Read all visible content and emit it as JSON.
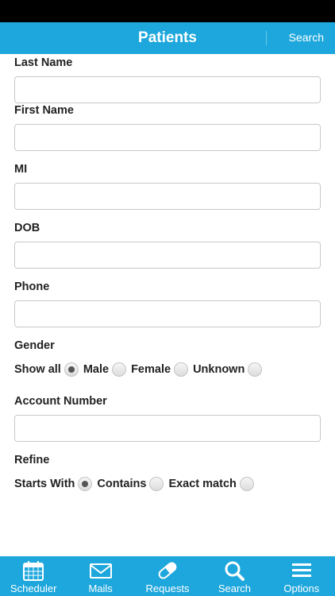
{
  "header": {
    "title": "Patients",
    "search_label": "Search"
  },
  "form": {
    "last_name": {
      "label": "Last Name",
      "value": ""
    },
    "first_name": {
      "label": "First Name",
      "value": ""
    },
    "mi": {
      "label": "MI",
      "value": ""
    },
    "dob": {
      "label": "DOB",
      "value": ""
    },
    "phone": {
      "label": "Phone",
      "value": ""
    },
    "gender": {
      "label": "Gender",
      "options": [
        "Show all",
        "Male",
        "Female",
        "Unknown"
      ],
      "selected": "Show all"
    },
    "account_number": {
      "label": "Account Number",
      "value": ""
    },
    "refine": {
      "label": "Refine",
      "options": [
        "Starts With",
        "Contains",
        "Exact match"
      ],
      "selected": "Starts With"
    }
  },
  "tabbar": {
    "items": [
      {
        "label": "Scheduler",
        "icon": "calendar-icon"
      },
      {
        "label": "Mails",
        "icon": "mail-icon"
      },
      {
        "label": "Requests",
        "icon": "pill-icon"
      },
      {
        "label": "Search",
        "icon": "search-icon"
      },
      {
        "label": "Options",
        "icon": "menu-icon"
      }
    ]
  }
}
